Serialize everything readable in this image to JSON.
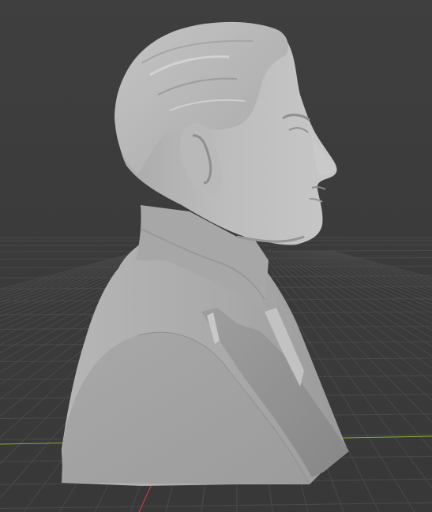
{
  "viewport": {
    "background_color": "#3d3d3d",
    "grid_line_color": "#4a4a4a",
    "x_axis_color": "#c63b3b",
    "y_axis_color": "#7fb335",
    "model": {
      "name": "bust-sculpture",
      "material_color": "#b3b3b3",
      "view": "side-profile-right"
    }
  }
}
